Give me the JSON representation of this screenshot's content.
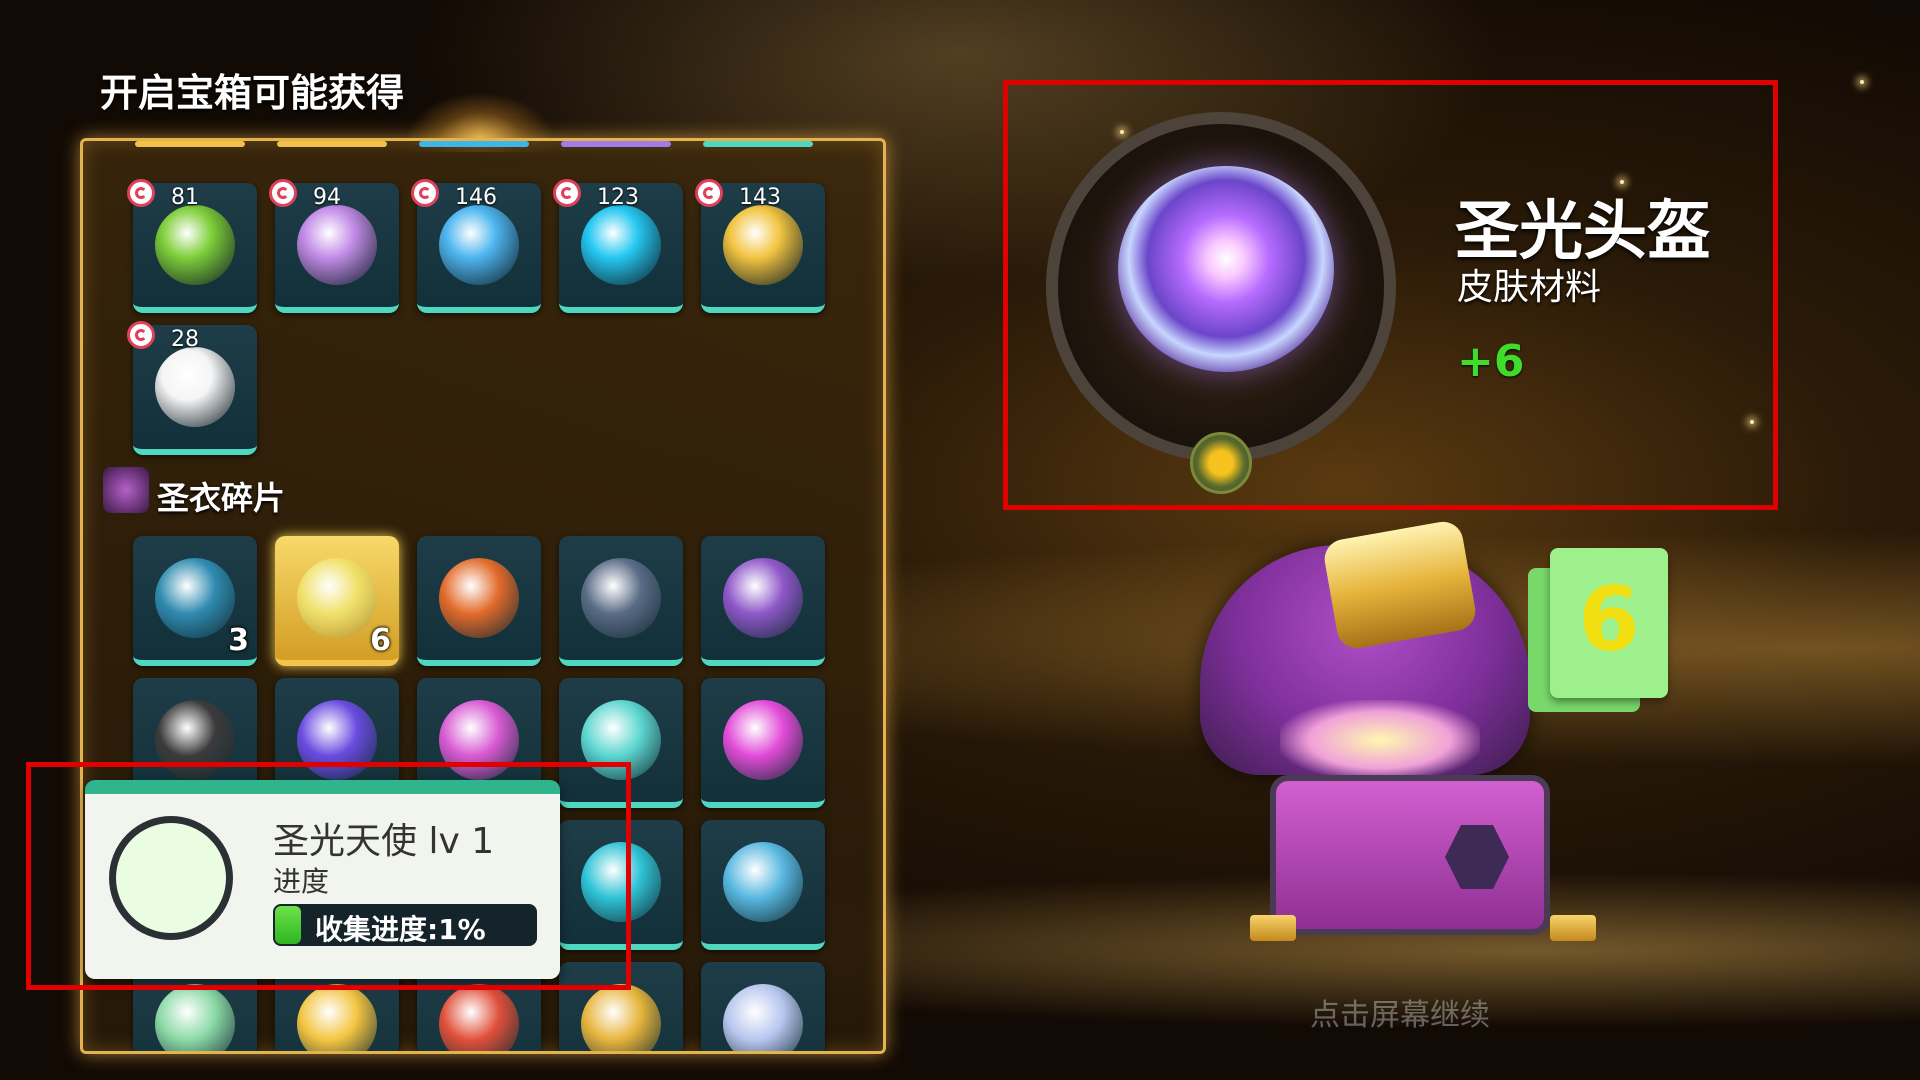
{
  "panel": {
    "title": "开启宝箱可能获得",
    "top_items": [
      {
        "count": "81",
        "icon": "green-swirl-orb",
        "color": "#7fcf3a"
      },
      {
        "count": "94",
        "icon": "purple-lightning-orb",
        "color": "#c38de8"
      },
      {
        "count": "146",
        "icon": "blue-bubble-orb",
        "color": "#4fb6f0"
      },
      {
        "count": "123",
        "icon": "cyan-ring-orb",
        "color": "#26c8f2"
      },
      {
        "count": "143",
        "icon": "golden-sword",
        "color": "#f3c542"
      },
      {
        "count": "28",
        "icon": "white-fox-mask",
        "color": "#f5f5f5"
      }
    ],
    "section_label": "圣衣碎片",
    "fragments": [
      {
        "qty": "3",
        "icon": "hex-sphere",
        "color": "#2f8bb0"
      },
      {
        "qty": "6",
        "icon": "holy-helmet-fragment",
        "color": "#f0e16a",
        "selected": true
      },
      {
        "qty": "",
        "icon": "flame-fragment",
        "color": "#e26a2a"
      },
      {
        "qty": "",
        "icon": "dark-bubble",
        "color": "#5a6b86"
      },
      {
        "qty": "",
        "icon": "purple-cat-head",
        "color": "#8e57c9"
      },
      {
        "qty": "",
        "icon": "fox-mask-dark",
        "color": "#3b3b3b"
      },
      {
        "qty": "",
        "icon": "violet-orb",
        "color": "#6a4be0"
      },
      {
        "qty": "",
        "icon": "pink-orange-orb",
        "color": "#d85ad2"
      },
      {
        "qty": "",
        "icon": "pastel-orb",
        "color": "#5cd6d0"
      },
      {
        "qty": "",
        "icon": "magenta-orb",
        "color": "#e24bd8"
      },
      {
        "qty": "",
        "icon": "orb-hidden-1",
        "color": "#7a6bd0"
      },
      {
        "qty": "",
        "icon": "orb-hidden-2",
        "color": "#6cc3a2"
      },
      {
        "qty": "",
        "icon": "green-glow-orb",
        "color": "#3ecf34"
      },
      {
        "qty": "",
        "icon": "teal-glow-orb",
        "color": "#2fc3d6"
      },
      {
        "qty": "",
        "icon": "aqua-orb",
        "color": "#58b8e0"
      },
      {
        "qty": "",
        "icon": "rainbow-orb",
        "color": "#8bd9a6"
      },
      {
        "qty": "",
        "icon": "gold-star-orb",
        "color": "#f3c542"
      },
      {
        "qty": "",
        "icon": "red-bow",
        "color": "#e0503a"
      },
      {
        "qty": "",
        "icon": "golden-harp",
        "color": "#e6b43c"
      },
      {
        "qty": "",
        "icon": "silver-ring",
        "color": "#b7c6ef"
      }
    ]
  },
  "progress": {
    "title": "圣光天使 lv 1",
    "subtitle": "进度",
    "bar_text": "收集进度:1%",
    "percent": 0.01
  },
  "reward": {
    "name": "圣光头盔",
    "type": "皮肤材料",
    "amount": "+6",
    "badge_icon": "puzzle-piece-icon"
  },
  "chest": {
    "count": "6",
    "hint": "点击屏幕继续"
  }
}
